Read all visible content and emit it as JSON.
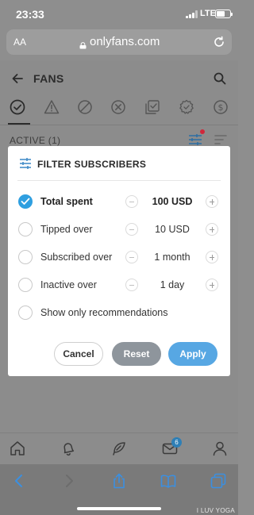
{
  "status_bar": {
    "time": "23:33",
    "network": "LTE"
  },
  "browser": {
    "text_size_label": "AA",
    "url": "onlyfans.com"
  },
  "app": {
    "page_title": "FANS",
    "filter_tabs": [
      {
        "icon": "check-circle-icon",
        "selected": true
      },
      {
        "icon": "warning-triangle-icon",
        "selected": false
      },
      {
        "icon": "blocked-circle-icon",
        "selected": false
      },
      {
        "icon": "x-circle-icon",
        "selected": false
      },
      {
        "icon": "check-squares-icon",
        "selected": false
      },
      {
        "icon": "gear-badge-icon",
        "selected": false
      },
      {
        "icon": "dollar-circle-icon",
        "selected": false
      }
    ],
    "active_label": "ACTIVE (1)"
  },
  "modal": {
    "title": "FILTER SUBSCRIBERS",
    "options": [
      {
        "label": "Total spent",
        "value": "100 USD",
        "checked": true
      },
      {
        "label": "Tipped over",
        "value": "10 USD",
        "checked": false
      },
      {
        "label": "Subscribed over",
        "value": "1 month",
        "checked": false
      },
      {
        "label": "Inactive over",
        "value": "1 day",
        "checked": false
      }
    ],
    "recommendations_label": "Show only recommendations",
    "buttons": {
      "cancel": "Cancel",
      "reset": "Reset",
      "apply": "Apply"
    }
  },
  "bottom_nav": {
    "items": [
      "home-icon",
      "bell-icon",
      "feather-icon",
      "messages-icon",
      "profile-icon"
    ],
    "messages_badge": "6"
  },
  "watermark": "I LUV YOGA",
  "colors": {
    "accent": "#57a7e3",
    "checked_radio": "#2f9fe0",
    "reset_button": "#8e959c",
    "notification_dot": "#d0273b",
    "overlay": "#8c8c8c"
  }
}
